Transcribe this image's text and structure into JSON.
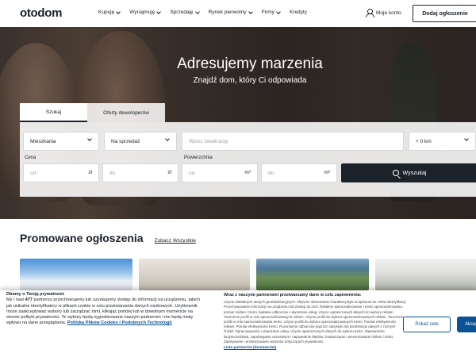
{
  "header": {
    "logo": "otodom",
    "nav": [
      {
        "label": "Kupuję",
        "icon": "chevron-down-icon"
      },
      {
        "label": "Wynajmuję",
        "icon": "chevron-down-icon"
      },
      {
        "label": "Sprzedaję",
        "icon": "chevron-down-icon"
      },
      {
        "label": "Rynek pierwotny",
        "icon": "chevron-down-icon"
      },
      {
        "label": "Firmy",
        "icon": "chevron-down-icon"
      },
      {
        "label": "Kredyty"
      }
    ],
    "account_label": "Moje konto",
    "add_listing_label": "Dodaj ogłoszenie"
  },
  "hero": {
    "title": "Adresujemy marzenia",
    "subtitle": "Znajdź dom, który Ci odpowiada"
  },
  "search": {
    "tabs": [
      {
        "label": "Szukaj",
        "active": true
      },
      {
        "label": "Oferty deweloperów",
        "active": false
      }
    ],
    "property_type": "Mieszkania",
    "transaction": "Na sprzedaż",
    "location_placeholder": "Wpisz lokalizację",
    "radius": "+ 0 km",
    "price_label": "Cena",
    "area_label": "Powierzchnia",
    "price_from": "od",
    "price_to": "do",
    "price_unit": "zł",
    "area_from": "od",
    "area_to": "do",
    "area_unit": "m²",
    "search_button": "Wyszukaj"
  },
  "promoted": {
    "title": "Promowane ogłoszenia",
    "see_all": "Zobacz Wszystkie"
  },
  "consent": {
    "heading": "Dbamy o Twoją prywatność",
    "partners_count": "477",
    "text_part1": "My i nasi ",
    "text_part2": " partnerzy przechowujemy lub uzyskujemy dostęp do informacji na urządzeniu, takich jak unikalne identyfikatory w plikach cookie w celu przetwarzania danych osobowych. Użytkownik może zaakceptować wybory lub zarządzać nimi, klikając poniżej lub w dowolnym momencie na stronie polityki prywatności. Te wybory będą sygnalizowane naszym partnerom i nie będą miały wpływu na dane przeglądania.",
    "policy_link": "Polityka Plików Cookies i Podobnych Technologii",
    "mid_title": "Wraz z naszymi partnerami przetwarzamy dane w celu zapewnienia:",
    "mid_body": "Użycie dokładnych danych geolokalizacyjnych. Aktywne skanowanie charakterystyki urządzenia do celów identyfikacji. Przechowywanie informacji na urządzeniu lub dostęp do nich. Reklamy spersonalizowane i treści spersonalizowane, pomiar reklam i treści, badania odbiorców i ulepszanie usług. Użycie ograniczonych danych do wyboru reklam. Tworzenie profili w celu spersonalizowanych reklam. Użycie profili do wyboru spersonalizowanych reklam. Tworzenie profili w celu spersonalizowania treści. Użycie profili do wyboru spersonalizowanych treści. Pomiar efektywności reklam. Pomiar efektywności treści. Rozumienie odbiorców poprzez statystyki lub kombinacje danych z różnych źródeł. Opracowywanie i ulepszanie usług. Użycie ograniczonych danych do wyboru treści. Zapewnienie bezpieczeństwa, zapobieganie oszustwom i naprawianie błędów. Dostarczanie i prezentowanie reklam i treści. Zapisywanie i przekazywanie wyborów dotyczących prywatności.",
    "partners_link": "Lista partnerów (dostawców)",
    "show_purposes": "Pokaż cele",
    "accept": "Akceptuj"
  }
}
